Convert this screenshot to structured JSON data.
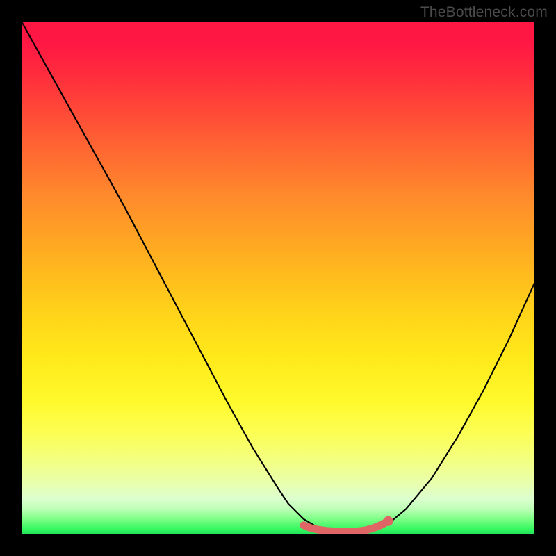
{
  "attribution": "TheBottleneck.com",
  "chart_data": {
    "type": "line",
    "title": "",
    "xlabel": "",
    "ylabel": "",
    "xlim": [
      0,
      100
    ],
    "ylim": [
      0,
      100
    ],
    "series": [
      {
        "name": "bottleneck-curve",
        "x": [
          0,
          5,
          10,
          15,
          20,
          25,
          30,
          35,
          40,
          45,
          50,
          52,
          55,
          58,
          60,
          63,
          65,
          68,
          70,
          72,
          75,
          80,
          85,
          90,
          95,
          100
        ],
        "values": [
          100,
          91,
          82,
          73,
          64,
          54.5,
          45,
          35.5,
          26,
          17,
          9,
          6,
          3,
          1.2,
          0.6,
          0.3,
          0.3,
          0.5,
          1.2,
          2.5,
          5,
          11,
          19,
          28,
          38,
          49
        ]
      },
      {
        "name": "optimal-marker",
        "x": [
          55,
          56.5,
          58,
          59.5,
          61,
          62.5,
          64,
          65.5,
          67,
          68.5,
          70,
          71.5
        ],
        "values": [
          1.8,
          1.2,
          0.9,
          0.7,
          0.6,
          0.55,
          0.55,
          0.6,
          0.8,
          1.2,
          1.8,
          2.6
        ]
      }
    ],
    "marker_end": {
      "x": 71.5,
      "y": 2.6
    },
    "colors": {
      "curve": "#000000",
      "marker": "#e06666",
      "gradient_top": "#ff1744",
      "gradient_mid": "#ffd11a",
      "gradient_bottom": "#1ee05a"
    }
  }
}
